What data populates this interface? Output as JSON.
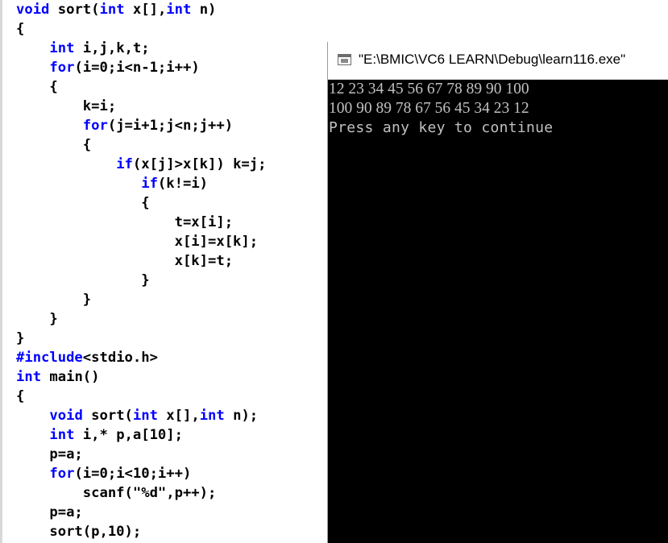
{
  "editor": {
    "lines": [
      [
        {
          "t": "void",
          "k": "kw"
        },
        {
          "t": " sort(",
          "k": "plain"
        },
        {
          "t": "int",
          "k": "kw"
        },
        {
          "t": " x[],",
          "k": "plain"
        },
        {
          "t": "int",
          "k": "kw"
        },
        {
          "t": " n)",
          "k": "plain"
        }
      ],
      [
        {
          "t": "{",
          "k": "plain"
        }
      ],
      [
        {
          "t": "    ",
          "k": "plain"
        },
        {
          "t": "int",
          "k": "kw"
        },
        {
          "t": " i,j,k,t;",
          "k": "plain"
        }
      ],
      [
        {
          "t": "    ",
          "k": "plain"
        },
        {
          "t": "for",
          "k": "kw"
        },
        {
          "t": "(i=0;i<n-1;i++)",
          "k": "plain"
        }
      ],
      [
        {
          "t": "    {",
          "k": "plain"
        }
      ],
      [
        {
          "t": "        k=i;",
          "k": "plain"
        }
      ],
      [
        {
          "t": "        ",
          "k": "plain"
        },
        {
          "t": "for",
          "k": "kw"
        },
        {
          "t": "(j=i+1;j<n;j++)",
          "k": "plain"
        }
      ],
      [
        {
          "t": "        {",
          "k": "plain"
        }
      ],
      [
        {
          "t": "            ",
          "k": "plain"
        },
        {
          "t": "if",
          "k": "kw"
        },
        {
          "t": "(x[j]>x[k]) k=j;",
          "k": "plain"
        }
      ],
      [
        {
          "t": "               ",
          "k": "plain"
        },
        {
          "t": "if",
          "k": "kw"
        },
        {
          "t": "(k!=i)",
          "k": "plain"
        }
      ],
      [
        {
          "t": "               {",
          "k": "plain"
        }
      ],
      [
        {
          "t": "                   t=x[i];",
          "k": "plain"
        }
      ],
      [
        {
          "t": "                   x[i]=x[k];",
          "k": "plain"
        }
      ],
      [
        {
          "t": "                   x[k]=t;",
          "k": "plain"
        }
      ],
      [
        {
          "t": "               }",
          "k": "plain"
        }
      ],
      [
        {
          "t": "        }",
          "k": "plain"
        }
      ],
      [
        {
          "t": "    }",
          "k": "plain"
        }
      ],
      [
        {
          "t": "}",
          "k": "plain"
        }
      ],
      [
        {
          "t": "#include",
          "k": "pp"
        },
        {
          "t": "<stdio.h>",
          "k": "plain"
        }
      ],
      [
        {
          "t": "int",
          "k": "kw"
        },
        {
          "t": " main()",
          "k": "plain"
        }
      ],
      [
        {
          "t": "{",
          "k": "plain"
        }
      ],
      [
        {
          "t": "    ",
          "k": "plain"
        },
        {
          "t": "void",
          "k": "kw"
        },
        {
          "t": " sort(",
          "k": "plain"
        },
        {
          "t": "int",
          "k": "kw"
        },
        {
          "t": " x[],",
          "k": "plain"
        },
        {
          "t": "int",
          "k": "kw"
        },
        {
          "t": " n);",
          "k": "plain"
        }
      ],
      [
        {
          "t": "    ",
          "k": "plain"
        },
        {
          "t": "int",
          "k": "kw"
        },
        {
          "t": " i,* p,a[10];",
          "k": "plain"
        }
      ],
      [
        {
          "t": "    p=a;",
          "k": "plain"
        }
      ],
      [
        {
          "t": "    ",
          "k": "plain"
        },
        {
          "t": "for",
          "k": "kw"
        },
        {
          "t": "(i=0;i<10;i++)",
          "k": "plain"
        }
      ],
      [
        {
          "t": "        scanf(\"%d\",p++);",
          "k": "plain"
        }
      ],
      [
        {
          "t": "    p=a;",
          "k": "plain"
        }
      ],
      [
        {
          "t": "    sort(p,10);",
          "k": "plain"
        }
      ]
    ]
  },
  "console": {
    "title": "\"E:\\BMIC\\VC6 LEARN\\Debug\\learn116.exe\"",
    "icon": "console-window-icon",
    "output": [
      "12 23 34 45 56 67 78 89 90 100",
      "100 90 89 78 67 56 45 34 23 12",
      "Press any key to continue"
    ]
  },
  "colors": {
    "keyword": "#0000ff",
    "code_text": "#000000",
    "console_bg": "#000000",
    "console_text": "#c0c0c0"
  }
}
